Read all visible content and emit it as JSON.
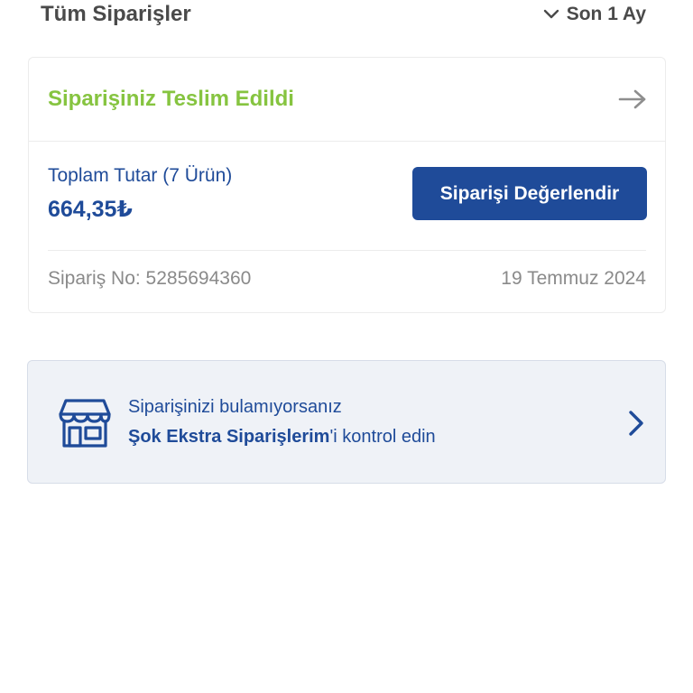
{
  "header": {
    "title": "Tüm Siparişler",
    "period_label": "Son 1 Ay",
    "period_icon": "chevron-down-icon"
  },
  "order": {
    "status": "Siparişiniz Teslim Edildi",
    "status_color": "#86c440",
    "total_label": "Toplam Tutar (7 Ürün)",
    "total_value": "664,35₺",
    "rate_button_label": "Siparişi Değerlendir",
    "order_no": "Sipariş No: 5285694360",
    "date": "19 Temmuz 2024",
    "accent_color": "#1f4b99"
  },
  "info": {
    "line1": "Siparişinizi bulamıyorsanız",
    "link_text": "Şok Ekstra Siparişlerim",
    "line2_suffix": "'i kontrol edin",
    "icon": "store-icon"
  }
}
